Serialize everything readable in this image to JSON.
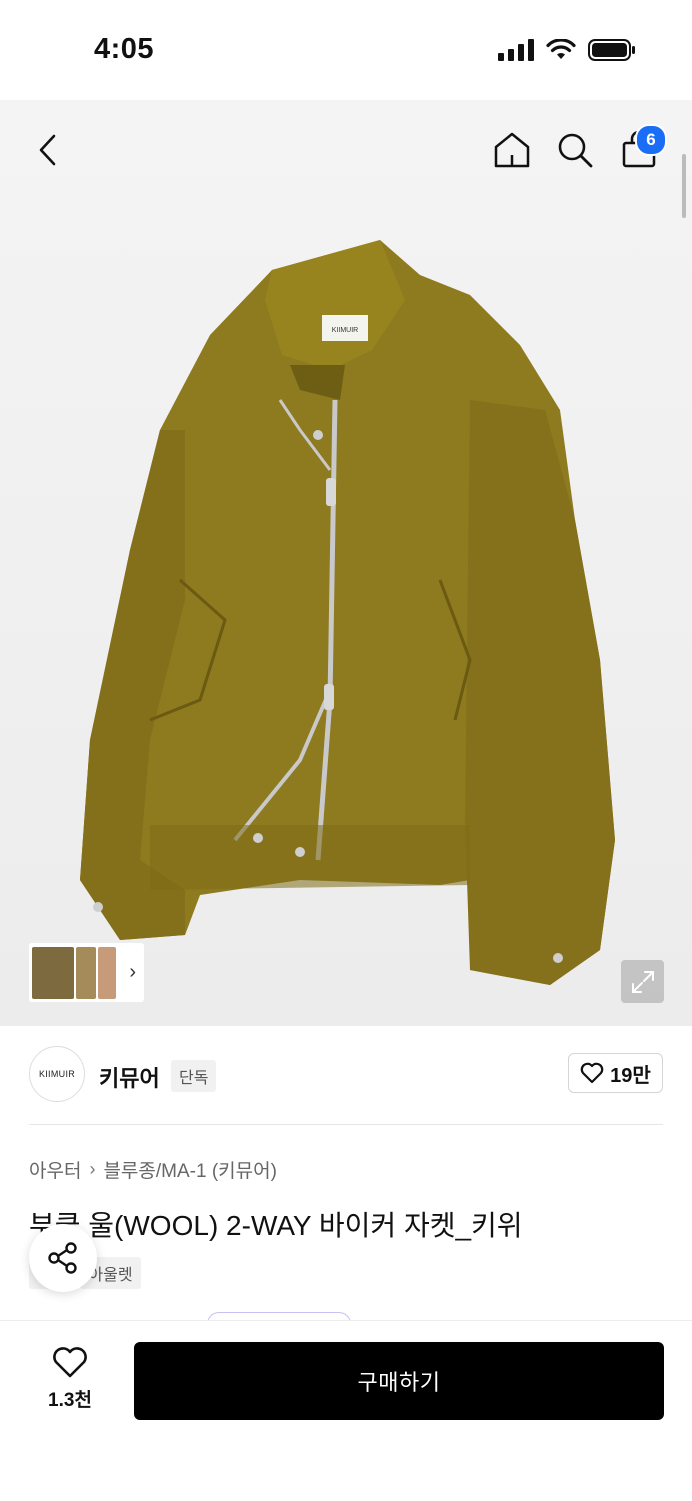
{
  "status": {
    "time": "4:05"
  },
  "header": {
    "cart_count": "6"
  },
  "hero": {
    "label_text": "KIIMUIR",
    "jacket_color": "#8e7a1f"
  },
  "brand": {
    "logo_text": "KIIMUIR",
    "name": "키뮤어",
    "tag": "단독",
    "like_count": "19만"
  },
  "breadcrumb": {
    "category": "아우터",
    "subcategory": "블루종/MA-1 (키뮤어)"
  },
  "product": {
    "title": "부클 울(WOOL) 2-WAY 바이커 자켓_키위",
    "tags": [
      "단독",
      "아울렛"
    ]
  },
  "bottom": {
    "wish_count": "1.3천",
    "buy_label": "구매하기"
  },
  "icons": [
    "back-icon",
    "home-icon",
    "search-icon",
    "shopping-bag-icon",
    "expand-icon",
    "heart-icon",
    "share-icon",
    "chevron-right-icon"
  ]
}
